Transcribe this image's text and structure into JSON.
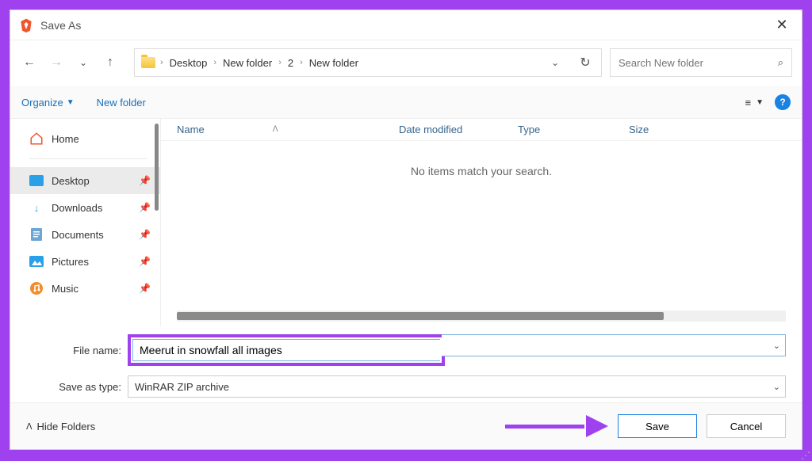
{
  "title": "Save As",
  "breadcrumbs": [
    "Desktop",
    "New folder",
    "2",
    "New folder"
  ],
  "search_placeholder": "Search New folder",
  "toolbar": {
    "organize": "Organize",
    "newfolder": "New folder"
  },
  "sidebar": {
    "home": "Home",
    "items": [
      {
        "label": "Desktop",
        "active": true
      },
      {
        "label": "Downloads"
      },
      {
        "label": "Documents"
      },
      {
        "label": "Pictures"
      },
      {
        "label": "Music"
      }
    ]
  },
  "columns": {
    "name": "Name",
    "date": "Date modified",
    "type": "Type",
    "size": "Size"
  },
  "empty_text": "No items match your search.",
  "filename_label": "File name:",
  "filename_value": "Meerut in snowfall all images",
  "savetype_label": "Save as type:",
  "savetype_value": "WinRAR ZIP archive",
  "hide_folders": "Hide Folders",
  "buttons": {
    "save": "Save",
    "cancel": "Cancel"
  }
}
